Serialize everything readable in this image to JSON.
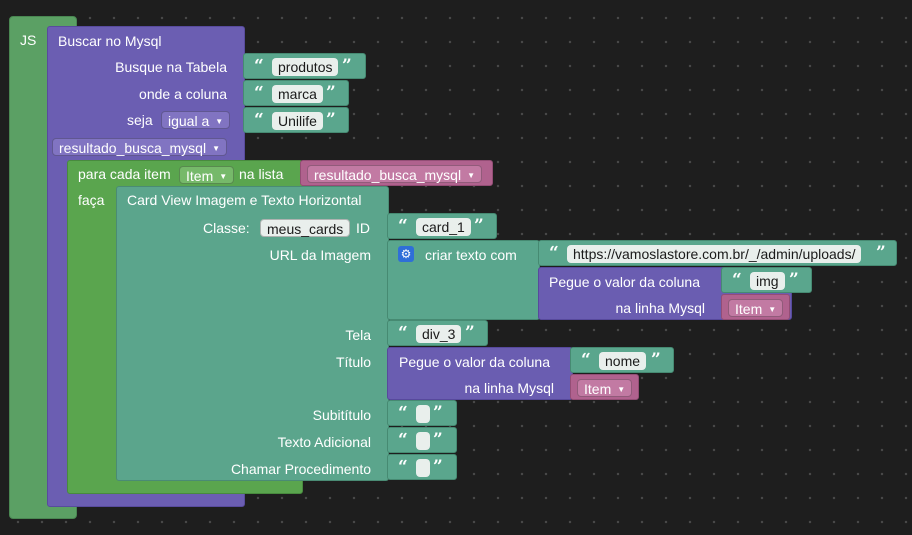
{
  "js_block": {
    "label": "JS"
  },
  "mysql_block": {
    "title": "Buscar no Mysql",
    "table_label": "Busque na Tabela",
    "table_value": "produtos",
    "column_label": "onde a coluna",
    "column_value": "marca",
    "seja_label": "seja",
    "operator": "igual a",
    "match_value": "Unilife",
    "result_var": "resultado_busca_mysql"
  },
  "foreach_block": {
    "label": "para cada item",
    "item_var": "Item",
    "list_label": "na lista",
    "list_var": "resultado_busca_mysql",
    "do_label": "faça"
  },
  "card_block": {
    "title": "Card View Imagem e Texto Horizontal",
    "class_label": "Classe:",
    "class_value": "meus_cards",
    "id_label": "ID",
    "id_value": "card_1",
    "image_url_label": "URL da Imagem",
    "create_text_label": "criar texto com",
    "url_prefix": "https://vamoslastore.com.br/_/admin/uploads/",
    "get_column_label": "Pegue o valor da coluna",
    "img_column": "img",
    "row_label": "na linha Mysql",
    "row_var": "Item",
    "screen_label": "Tela",
    "screen_value": "div_3",
    "title_label": "Título",
    "title_get_label": "Pegue o valor da coluna",
    "title_column": "nome",
    "title_row_label": "na linha Mysql",
    "title_row_var": "Item",
    "subtitle_label": "Subitítulo",
    "extra_text_label": "Texto Adicional",
    "procedure_label": "Chamar Procedimento"
  },
  "icons": {
    "open_quote": "“",
    "close_quote": "”",
    "dropdown_arrow": "▼",
    "gear": "⚙"
  },
  "colors": {
    "js_block": "#5ba064",
    "mysql_block": "#6b5eb2",
    "loop_block": "#5aa54e",
    "card_block": "#5ba58c",
    "text_block": "#5aa68d",
    "variable_block": "#b0628e"
  }
}
